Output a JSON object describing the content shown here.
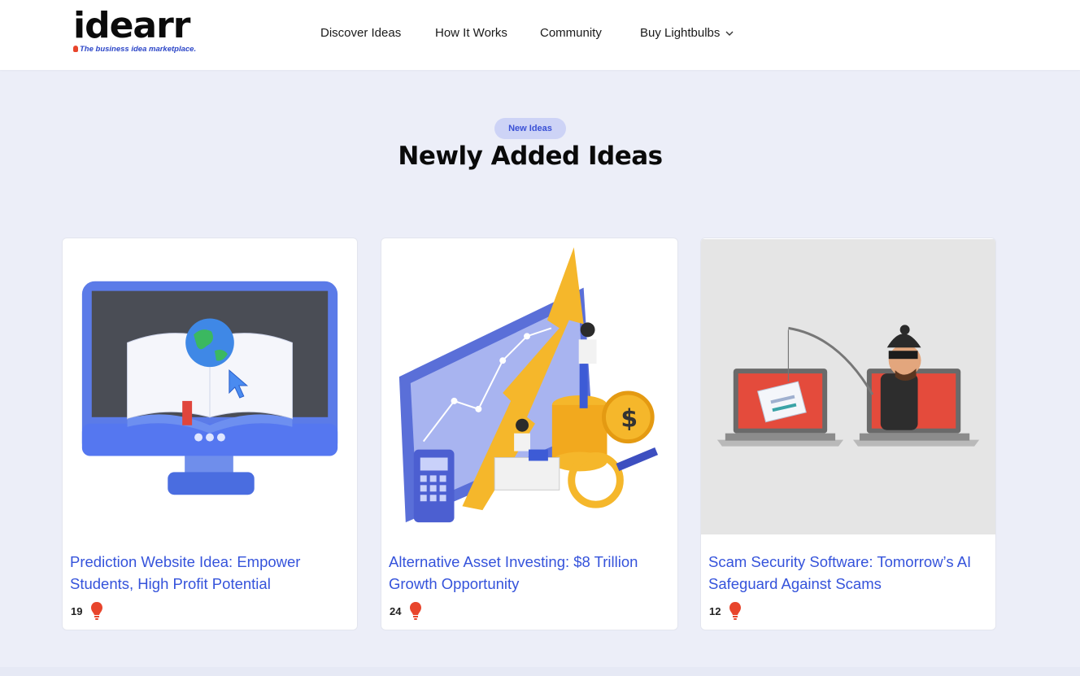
{
  "brand": {
    "name": "idearr",
    "tagline": "The business idea marketplace."
  },
  "nav": {
    "items": [
      "Discover Ideas",
      "How It Works",
      "Community",
      "Buy Lightbulbs"
    ]
  },
  "section": {
    "badge": "New Ideas",
    "title": "Newly Added Ideas"
  },
  "cards": [
    {
      "title": "Prediction Website Idea: Empower Students, High Profit Potential",
      "votes": "19",
      "image": "education-monitor-illustration"
    },
    {
      "title": "Alternative Asset Investing: $8 Trillion Growth Opportunity",
      "votes": "24",
      "image": "investment-growth-illustration"
    },
    {
      "title": "Scam Security Software: Tomorrow’s AI Safeguard Against Scams",
      "votes": "12",
      "image": "phishing-scam-illustration"
    }
  ],
  "colors": {
    "accent": "#3553DB",
    "background": "#ECEEF8",
    "pill_bg": "#CDD3F6",
    "bulb": "#E8452C"
  }
}
